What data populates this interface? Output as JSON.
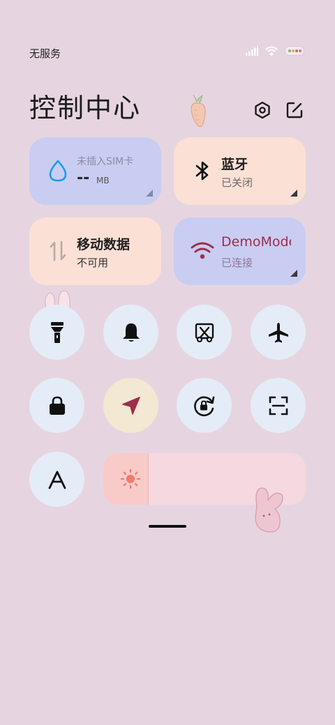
{
  "status_bar": {
    "carrier": "无服务",
    "icons": [
      "signal-icon",
      "wifi-icon",
      "battery-icon"
    ]
  },
  "header": {
    "title": "控制中心",
    "buttons": [
      "settings-icon",
      "edit-icon"
    ]
  },
  "tiles": {
    "data_usage": {
      "label": "未插入SIM卡",
      "value": "--",
      "unit": "MB",
      "icon": "water-drop-icon"
    },
    "bluetooth": {
      "title": "蓝牙",
      "status": "已关闭",
      "icon": "bluetooth-icon"
    },
    "mobile_data": {
      "title": "移动数据",
      "status": "不可用",
      "icon": "data-arrows-icon"
    },
    "wifi": {
      "title": "DemoMode",
      "status": "已连接",
      "icon": "wifi-icon"
    }
  },
  "toggles": [
    {
      "name": "flashlight",
      "icon": "flashlight-icon"
    },
    {
      "name": "ringer",
      "icon": "bell-icon"
    },
    {
      "name": "screenshot",
      "icon": "screenshot-scissors-icon"
    },
    {
      "name": "airplane-mode",
      "icon": "airplane-icon"
    },
    {
      "name": "lock-screen",
      "icon": "lock-icon"
    },
    {
      "name": "location",
      "icon": "location-arrow-icon",
      "active": true
    },
    {
      "name": "auto-rotate",
      "icon": "rotation-lock-icon"
    },
    {
      "name": "scanner",
      "icon": "scan-icon"
    },
    {
      "name": "reading-mode",
      "icon": "font-a-icon"
    }
  ],
  "brightness": {
    "level": 0.22,
    "icon": "sun-icon"
  },
  "colors": {
    "background": "#e6d5e0",
    "tile_blue": "#c9cdf1",
    "tile_peach": "#fbe0d5",
    "round_button": "#e4ecf8",
    "location_active": "#f3e8d2",
    "accent_blue": "#1e9be8",
    "wifi_red": "#9b2f4b",
    "slider_track": "#f5d8e0",
    "slider_fill": "#f8cac8"
  }
}
